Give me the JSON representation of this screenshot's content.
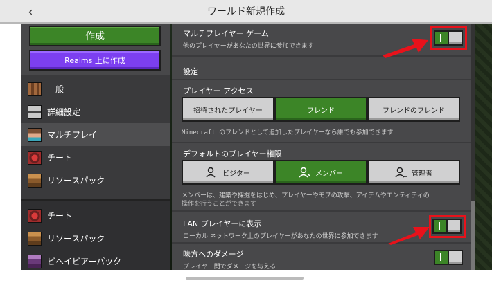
{
  "header": {
    "title": "ワールド新規作成",
    "back_glyph": "‹"
  },
  "sidebar": {
    "create_label": "作成",
    "realms_label": "Realms 上に作成",
    "items": [
      {
        "label": "一般",
        "icon": "command-block-icon"
      },
      {
        "label": "詳細設定",
        "icon": "advanced-settings-icon"
      },
      {
        "label": "マルチプレイ",
        "icon": "player-head-icon",
        "active": true
      },
      {
        "label": "チート",
        "icon": "cheat-icon"
      },
      {
        "label": "リソースパック",
        "icon": "chest-icon"
      }
    ],
    "popup_items": [
      {
        "label": "チート",
        "icon": "cheat-icon"
      },
      {
        "label": "リソースパック",
        "icon": "chest-icon"
      },
      {
        "label": "ビヘイビアーパック",
        "icon": "behavior-pack-icon"
      }
    ]
  },
  "main": {
    "multiplayer": {
      "title": "マルチプレイヤー ゲーム",
      "desc": "他のプレイヤーがあなたの世界に参加できます",
      "on": true
    },
    "settings_heading": "設定",
    "player_access": {
      "title": "プレイヤー アクセス",
      "options": [
        "招待されたプレイヤー",
        "フレンド",
        "フレンドのフレンド"
      ],
      "selected": "フレンド",
      "hint": "Minecraft のフレンドとして追加したプレイヤーなら誰でも参加できます"
    },
    "default_permission": {
      "title": "デフォルトのプレイヤー権限",
      "options": [
        "ビジター",
        "メンバー",
        "管理者"
      ],
      "selected": "メンバー",
      "hint_line1": "メンバーは、建築や採掘をはじめ、プレイヤーやモブの攻撃、アイテムやエンティティの",
      "hint_line2": "操作を行うことができます"
    },
    "lan": {
      "title": "LAN プレイヤーに表示",
      "desc": "ローカル ネットワーク上のプレイヤーがあなたの世界に参加できます",
      "on": true
    },
    "friendly_fire": {
      "title": "味方へのダメージ",
      "desc": "プレイヤー間でダメージを与える",
      "on": true
    }
  },
  "colors": {
    "accent_green": "#3c8527",
    "realms_purple": "#7c3ff0",
    "highlight_red": "#e8121b"
  }
}
